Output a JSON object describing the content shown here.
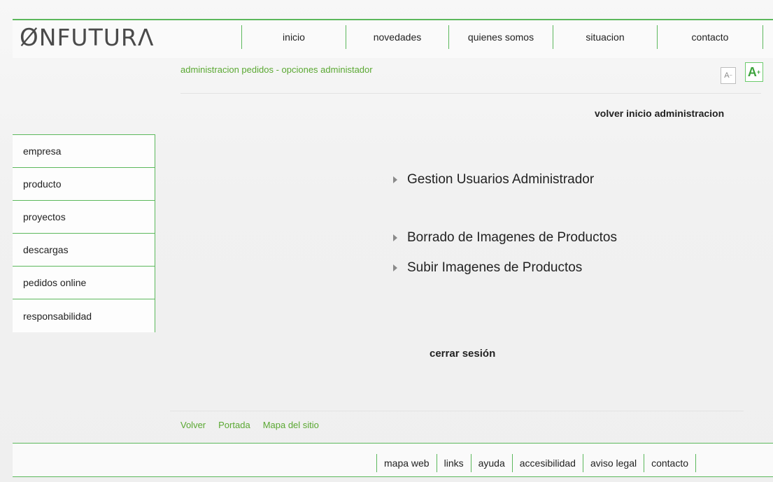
{
  "brand": {
    "logo_symbol": "Ø",
    "logo_text": "NFUTURΛ"
  },
  "top_nav": [
    "inicio",
    "novedades",
    "quienes somos",
    "situacion",
    "contacto"
  ],
  "breadcrumb": "administracion pedidos - opciones administador",
  "font_controls": {
    "smaller": "A",
    "larger": "A"
  },
  "volver_inicio": "volver inicio administracion",
  "sidebar": [
    "empresa",
    "producto",
    "proyectos",
    "descargas",
    "pedidos online",
    "responsabilidad"
  ],
  "admin_links": [
    "Gestion Usuarios Administrador",
    "Borrado de Imagenes de Productos",
    "Subir Imagenes de Productos"
  ],
  "logout": "cerrar sesión",
  "footer_links": [
    "Volver",
    "Portada",
    "Mapa del sitio"
  ],
  "bottom_nav": [
    "mapa web",
    "links",
    "ayuda",
    "accesibilidad",
    "aviso legal",
    "contacto"
  ],
  "colors": {
    "accent": "#5cb85c",
    "link_green": "#5aa832"
  }
}
